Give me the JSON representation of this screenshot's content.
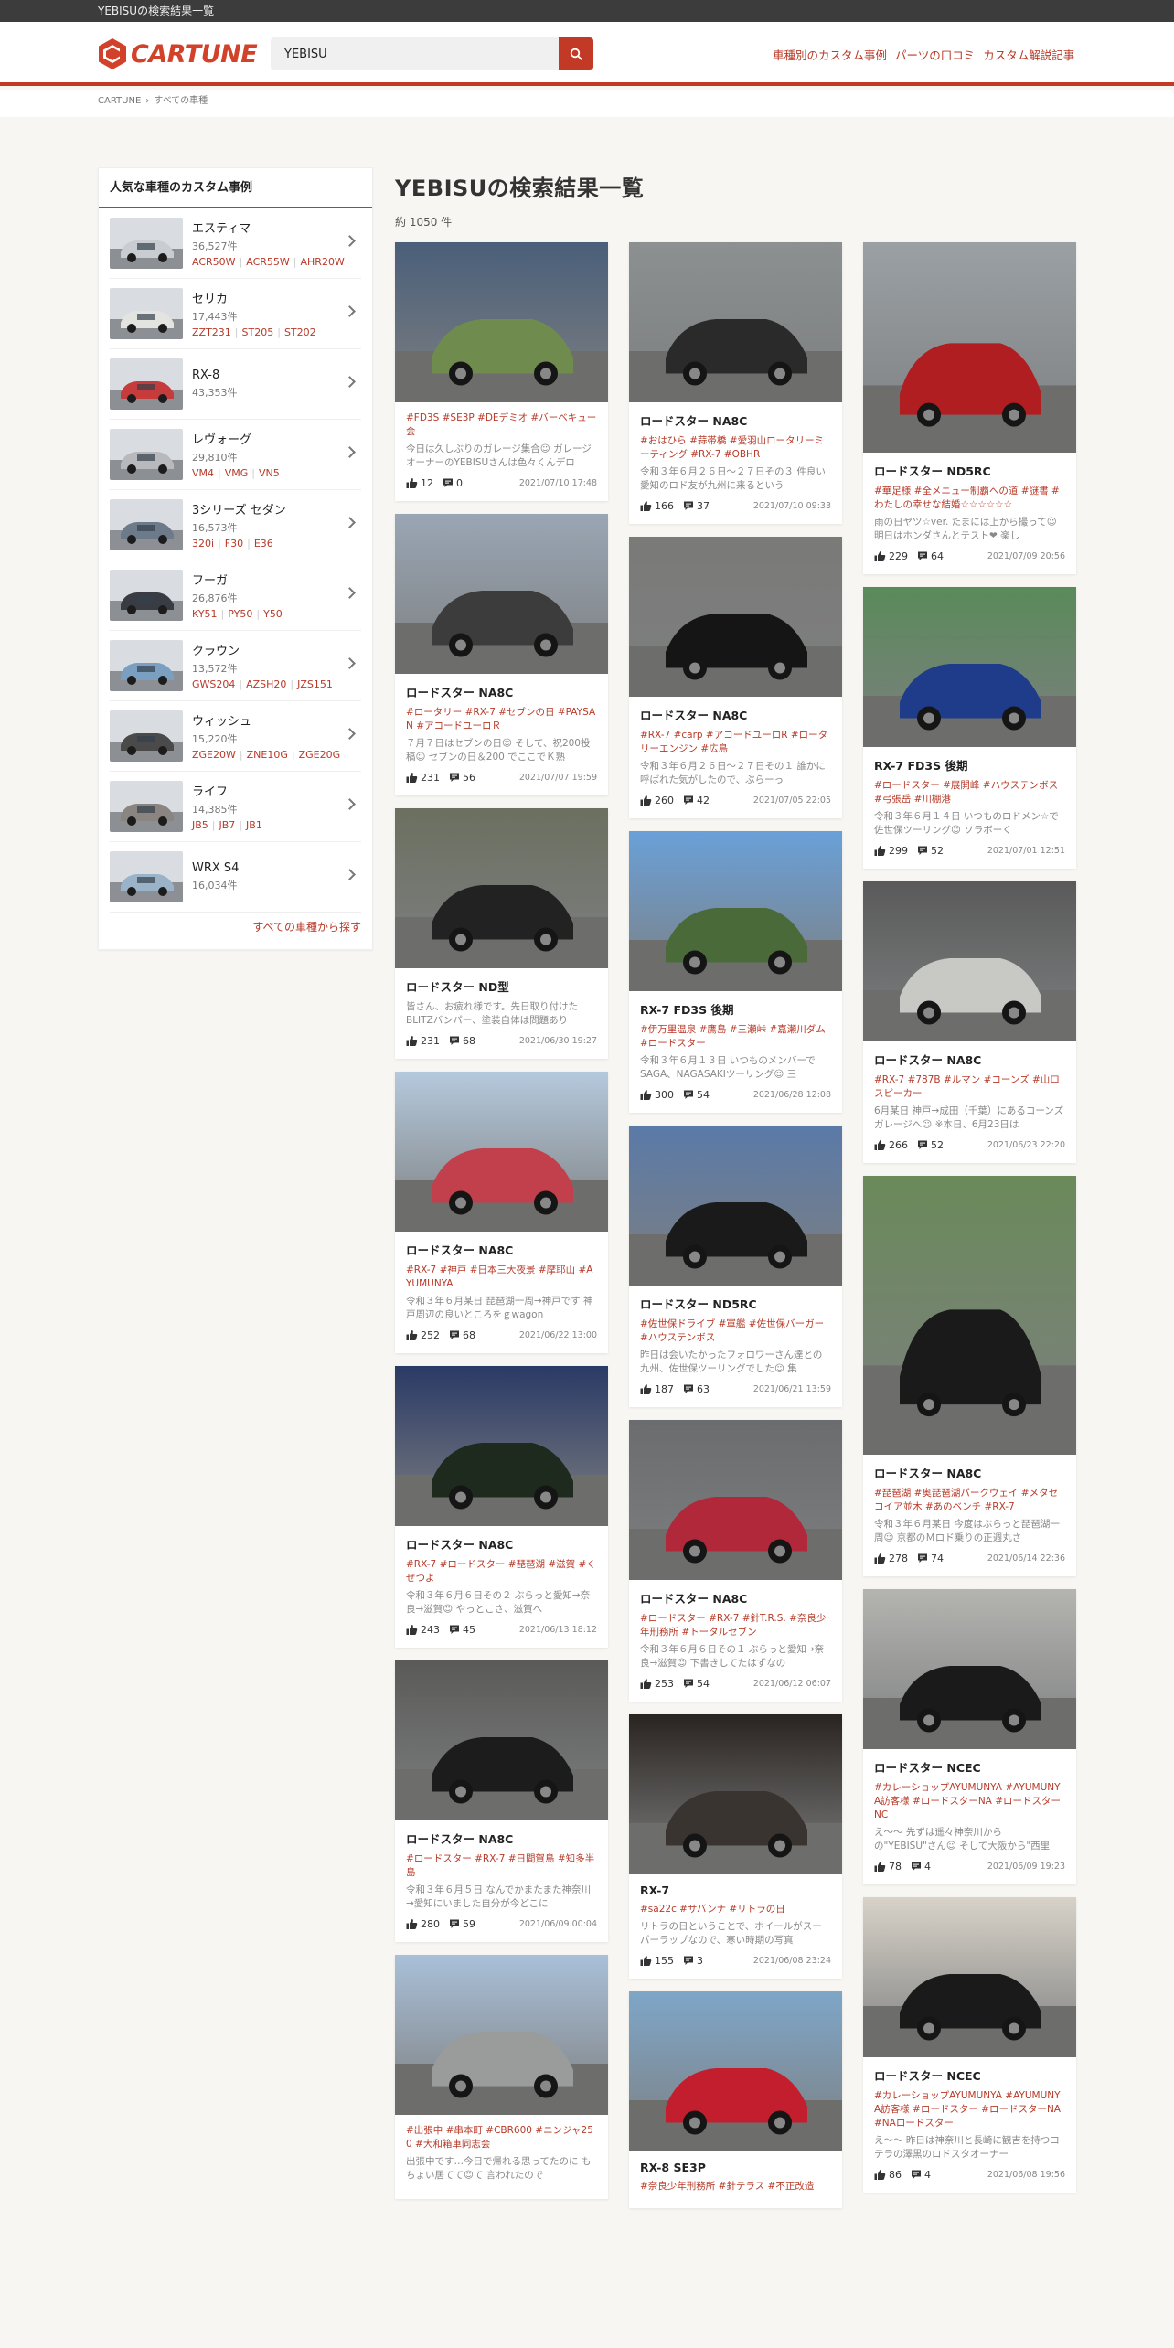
{
  "window_title": "YEBISUの検索結果一覧",
  "brand": "CARTUNE",
  "search": {
    "value": "YEBISU"
  },
  "nav": [
    "車種別のカスタム事例",
    "パーツの口コミ",
    "カスタム解説記事"
  ],
  "breadcrumb": [
    "CARTUNE",
    "すべての車種"
  ],
  "sidebar": {
    "title": "人気な車種のカスタム事例",
    "more_label": "すべての車種から探す",
    "items": [
      {
        "name": "エスティマ",
        "count": "36,527件",
        "codes": [
          "ACR50W",
          "ACR55W",
          "AHR20W"
        ],
        "color": "#c9ccd1"
      },
      {
        "name": "セリカ",
        "count": "17,443件",
        "codes": [
          "ZZT231",
          "ST205",
          "ST202"
        ],
        "color": "#e3e3e0"
      },
      {
        "name": "RX-8",
        "count": "43,353件",
        "codes": [],
        "color": "#c63b3b"
      },
      {
        "name": "レヴォーグ",
        "count": "29,810件",
        "codes": [
          "VM4",
          "VMG",
          "VN5"
        ],
        "color": "#b7b9bc"
      },
      {
        "name": "3シリーズ セダン",
        "count": "16,573件",
        "codes": [
          "320i",
          "F30",
          "E36"
        ],
        "color": "#6c7a8a"
      },
      {
        "name": "フーガ",
        "count": "26,876件",
        "codes": [
          "KY51",
          "PY50",
          "Y50"
        ],
        "color": "#3a3c44"
      },
      {
        "name": "クラウン",
        "count": "13,572件",
        "codes": [
          "GWS204",
          "AZSH20",
          "JZS151"
        ],
        "color": "#7b9fc1"
      },
      {
        "name": "ウィッシュ",
        "count": "15,220件",
        "codes": [
          "ZGE20W",
          "ZNE10G",
          "ZGE20G"
        ],
        "color": "#4a4a4a"
      },
      {
        "name": "ライフ",
        "count": "14,385件",
        "codes": [
          "JB5",
          "JB7",
          "JB1"
        ],
        "color": "#8a8580"
      },
      {
        "name": "WRX S4",
        "count": "16,034件",
        "codes": [],
        "color": "#9bb3c9"
      }
    ]
  },
  "results": {
    "title": "YEBISUの検索結果一覧",
    "count": "約 1050 件"
  },
  "columns": [
    [
      {
        "title": "",
        "tags": "#FD3S #SE3P #DEデミオ #バーベキュー会",
        "desc": "今日は久しぶりのガレージ集合☺ ガレージオーナーのYEBISUさんは色々くんデロ",
        "likes": "12",
        "comments": "0",
        "date": "2021/07/10 17:48",
        "img_h": 175,
        "c1": "#4a5f7a",
        "c2": "#6f8b4e"
      },
      {
        "title": "ロードスター NA8C",
        "tags": "#ロータリー #RX-7 #セブンの日 #PAYSAN #アコードユーロＲ",
        "desc": "７月７日はセブンの日☺ そして、祝200投稿☺ セブンの日＆200 でここでＫ熟",
        "likes": "231",
        "comments": "56",
        "date": "2021/07/07 19:59",
        "img_h": 175,
        "c1": "#9aa6b4",
        "c2": "#3c3c3c"
      },
      {
        "title": "ロードスター ND型",
        "tags": "",
        "desc": "皆さん、お疲れ様です。先日取り付けたBLITZバンパー、塗装自体は問題あり",
        "likes": "231",
        "comments": "68",
        "date": "2021/06/30 19:27",
        "img_h": 175,
        "c1": "#6b7060",
        "c2": "#222"
      },
      {
        "title": "ロードスター NA8C",
        "tags": "#RX-7 #神戸 #日本三大夜景 #摩耶山 #AYUMUNYA",
        "desc": "令和３年６月某日 琵琶湖一周→神戸です 神戸周辺の良いところをｇwagon",
        "likes": "252",
        "comments": "68",
        "date": "2021/06/22 13:00",
        "img_h": 175,
        "c1": "#b5c9dc",
        "c2": "#c2404c"
      },
      {
        "title": "ロードスター NA8C",
        "tags": "#RX-7 #ロードスター #琵琶湖 #滋賀 #くぜつよ",
        "desc": "令和３年６月６日その２ ぶらっと愛知→奈良→滋賀☺ やっとこさ、滋賀へ",
        "likes": "243",
        "comments": "45",
        "date": "2021/06/13 18:12",
        "img_h": 175,
        "c1": "#2a3a66",
        "c2": "#1e2a1e"
      },
      {
        "title": "ロードスター NA8C",
        "tags": "#ロードスター #RX-7 #日間賀島 #知多半島",
        "desc": "令和３年６月５日 なんでかまたまた神奈川→愛知にいました自分が今どこに",
        "likes": "280",
        "comments": "59",
        "date": "2021/06/09 00:04",
        "img_h": 175,
        "c1": "#5a5a58",
        "c2": "#1c1c1c"
      },
      {
        "title": "",
        "tags": "#出張中 #串本町 #CBR600 #ニンジャ250 #大和箱車同志会",
        "desc": "出張中です…今日で帰れる思ってたのに もちょい居てて☺て 言われたので",
        "likes": "",
        "comments": "",
        "date": "",
        "img_h": 175,
        "c1": "#a9c0d8",
        "c2": "#9a9c9c"
      }
    ],
    [
      {
        "title": "ロードスター NA8C",
        "tags": "#おはひら #蒜帯橋 #愛羽山ロータリーミーティング #RX-7 #OBHR",
        "desc": "令和３年６月２６日～２７日その３ 件良い愛知のロド友が九州に来るという",
        "likes": "166",
        "comments": "37",
        "date": "2021/07/10 09:33",
        "img_h": 175,
        "c1": "#8c9090",
        "c2": "#2a2a2a"
      },
      {
        "title": "ロードスター NA8C",
        "tags": "#RX-7 #carp #アコードユーロR #ロータリーエンジン #広島",
        "desc": "令和３年６月２６日～２７日その１ 誰かに呼ばれた気がしたので、ぶらーっ",
        "likes": "260",
        "comments": "42",
        "date": "2021/07/05 22:05",
        "img_h": 175,
        "c1": "#7a7a78",
        "c2": "#151515"
      },
      {
        "title": "RX-7 FD3S 後期",
        "tags": "#伊万里温泉 #鷹島 #三瀬峠 #嘉瀬川ダム #ロードスター",
        "desc": "令和３年６月１３日 いつものメンバーでSAGA、NAGASAKIツーリング☺ 三",
        "likes": "300",
        "comments": "54",
        "date": "2021/06/28 12:08",
        "img_h": 175,
        "c1": "#6aa0d8",
        "c2": "#4a6a3a"
      },
      {
        "title": "ロードスター ND5RC",
        "tags": "#佐世保ドライブ #軍艦 #佐世保バーガー #ハウステンボス",
        "desc": "昨日は会いたかったフォロワーさん達との九州、佐世保ツーリングでした☺ 集",
        "likes": "187",
        "comments": "63",
        "date": "2021/06/21 13:59",
        "img_h": 175,
        "c1": "#5a7aa8",
        "c2": "#1a1a1a"
      },
      {
        "title": "ロードスター NA8C",
        "tags": "#ロードスター #RX-7 #針T.R.S. #奈良少年刑務所 #トータルセブン",
        "desc": "令和３年６月６日その１ ぶらっと愛知→奈良→滋賀☺ 下書きしてたはずなの",
        "likes": "253",
        "comments": "54",
        "date": "2021/06/12 06:07",
        "img_h": 175,
        "c1": "#6a6c6e",
        "c2": "#b0283a"
      },
      {
        "title": "RX-7",
        "tags": "#sa22c #サバンナ #リトラの日",
        "desc": "リトラの日ということで、ホイールがスーパーラップなので、寒い時期の写真",
        "likes": "155",
        "comments": "3",
        "date": "2021/06/08 23:24",
        "img_h": 175,
        "c1": "#2a2420",
        "c2": "#3a3430"
      },
      {
        "title": "RX-8 SE3P",
        "tags": "#奈良少年刑務所 #針テラス #不正改造",
        "desc": "",
        "likes": "",
        "comments": "",
        "date": "",
        "img_h": 175,
        "c1": "#7ea6c8",
        "c2": "#c21e2e"
      }
    ],
    [
      {
        "title": "ロードスター ND5RC",
        "tags": "#華足様 #全メニュー制覇への道 #謎書 #わたしの幸せな結婚☆☆☆☆☆☆",
        "desc": "雨の日ヤツ☆ver. たまには上から撮って☺ 明日はホンダさんとテスト❤ 楽し",
        "likes": "229",
        "comments": "64",
        "date": "2021/07/09 20:56",
        "img_h": 230,
        "c1": "#9aa0a4",
        "c2": "#b01e22"
      },
      {
        "title": "RX-7 FD3S 後期",
        "tags": "#ロードスター #展開峰 #ハウステンボス #弓張岳 #川棚港",
        "desc": "令和３年６月１４日 いつものロドメン☆で佐世保ツーリング☺ ソラボーく",
        "likes": "299",
        "comments": "52",
        "date": "2021/07/01 12:51",
        "img_h": 175,
        "c1": "#5a8a5a",
        "c2": "#1e3c8a"
      },
      {
        "title": "ロードスター NA8C",
        "tags": "#RX-7 #787B #ルマン #コーンズ #山口スピーカー",
        "desc": "6月某日 神戸→成田（千葉）にあるコーンズガレージへ☺ ※本日、6月23日は",
        "likes": "266",
        "comments": "52",
        "date": "2021/06/23 22:20",
        "img_h": 175,
        "c1": "#5a5a5a",
        "c2": "#c8c8c4"
      },
      {
        "title": "ロードスター NA8C",
        "tags": "#琵琶湖 #奥琵琶湖パークウェイ #メタセコイア並木 #あのベンチ #RX-7",
        "desc": "令和３年６月某日 今度はぶらっと琵琶湖一周☺ 京都のＭロド乗りの正週丸さ",
        "likes": "278",
        "comments": "74",
        "date": "2021/06/14 22:36",
        "img_h": 305,
        "c1": "#6a8a5a",
        "c2": "#1a1a1a"
      },
      {
        "title": "ロードスター NCEC",
        "tags": "#カレーショップAYUMUNYA #AYUMUNYA訪客様 #ロードスターNA #ロードスターNC",
        "desc": "え～～ 先ずは遥々神奈川から の\"YEBISU\"さん☺ そして大阪から\"西里",
        "likes": "78",
        "comments": "4",
        "date": "2021/06/09 19:23",
        "img_h": 175,
        "c1": "#b4b4b0",
        "c2": "#1a1a1a"
      },
      {
        "title": "ロードスター NCEC",
        "tags": "#カレーショップAYUMUNYA #AYUMUNYA訪客様 #ロードスター #ロードスターNA #NAロードスター",
        "desc": "え～～ 昨日は神奈川と長崎に観吉を持つコテラの澤黒のロドスタオーナー",
        "likes": "86",
        "comments": "4",
        "date": "2021/06/08 19:56",
        "img_h": 175,
        "c1": "#d8d2c8",
        "c2": "#1a1a1a"
      }
    ]
  ]
}
